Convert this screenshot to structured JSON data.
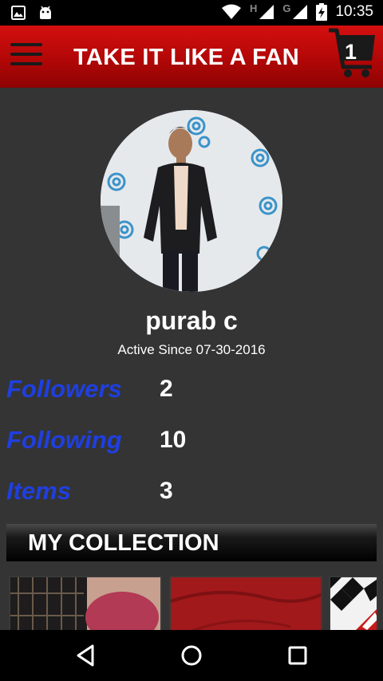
{
  "status_bar": {
    "time": "10:35",
    "network_letters": [
      "H",
      "G"
    ],
    "icons": [
      "image-icon",
      "android-icon",
      "wifi-icon",
      "signal-icon",
      "signal-icon",
      "battery-charging-icon"
    ]
  },
  "app_bar": {
    "title": "TAKE IT LIKE A FAN",
    "cart_count": "1",
    "menu_icon": "hamburger-menu-icon",
    "cart_icon": "shopping-cart-icon"
  },
  "profile": {
    "name": "purab c",
    "active_since": "Active Since 07-30-2016"
  },
  "stats": [
    {
      "label": "Followers",
      "value": "2"
    },
    {
      "label": "Following",
      "value": "10"
    },
    {
      "label": "Items",
      "value": "3"
    }
  ],
  "collection": {
    "title": "MY COLLECTION"
  },
  "nav_bar": {
    "icons": [
      "back-triangle-icon",
      "home-circle-icon",
      "recents-square-icon"
    ]
  },
  "colors": {
    "app_bar": "#c10b0b",
    "background": "#343434",
    "stat_label": "#1f3fe0",
    "text": "#ffffff"
  }
}
